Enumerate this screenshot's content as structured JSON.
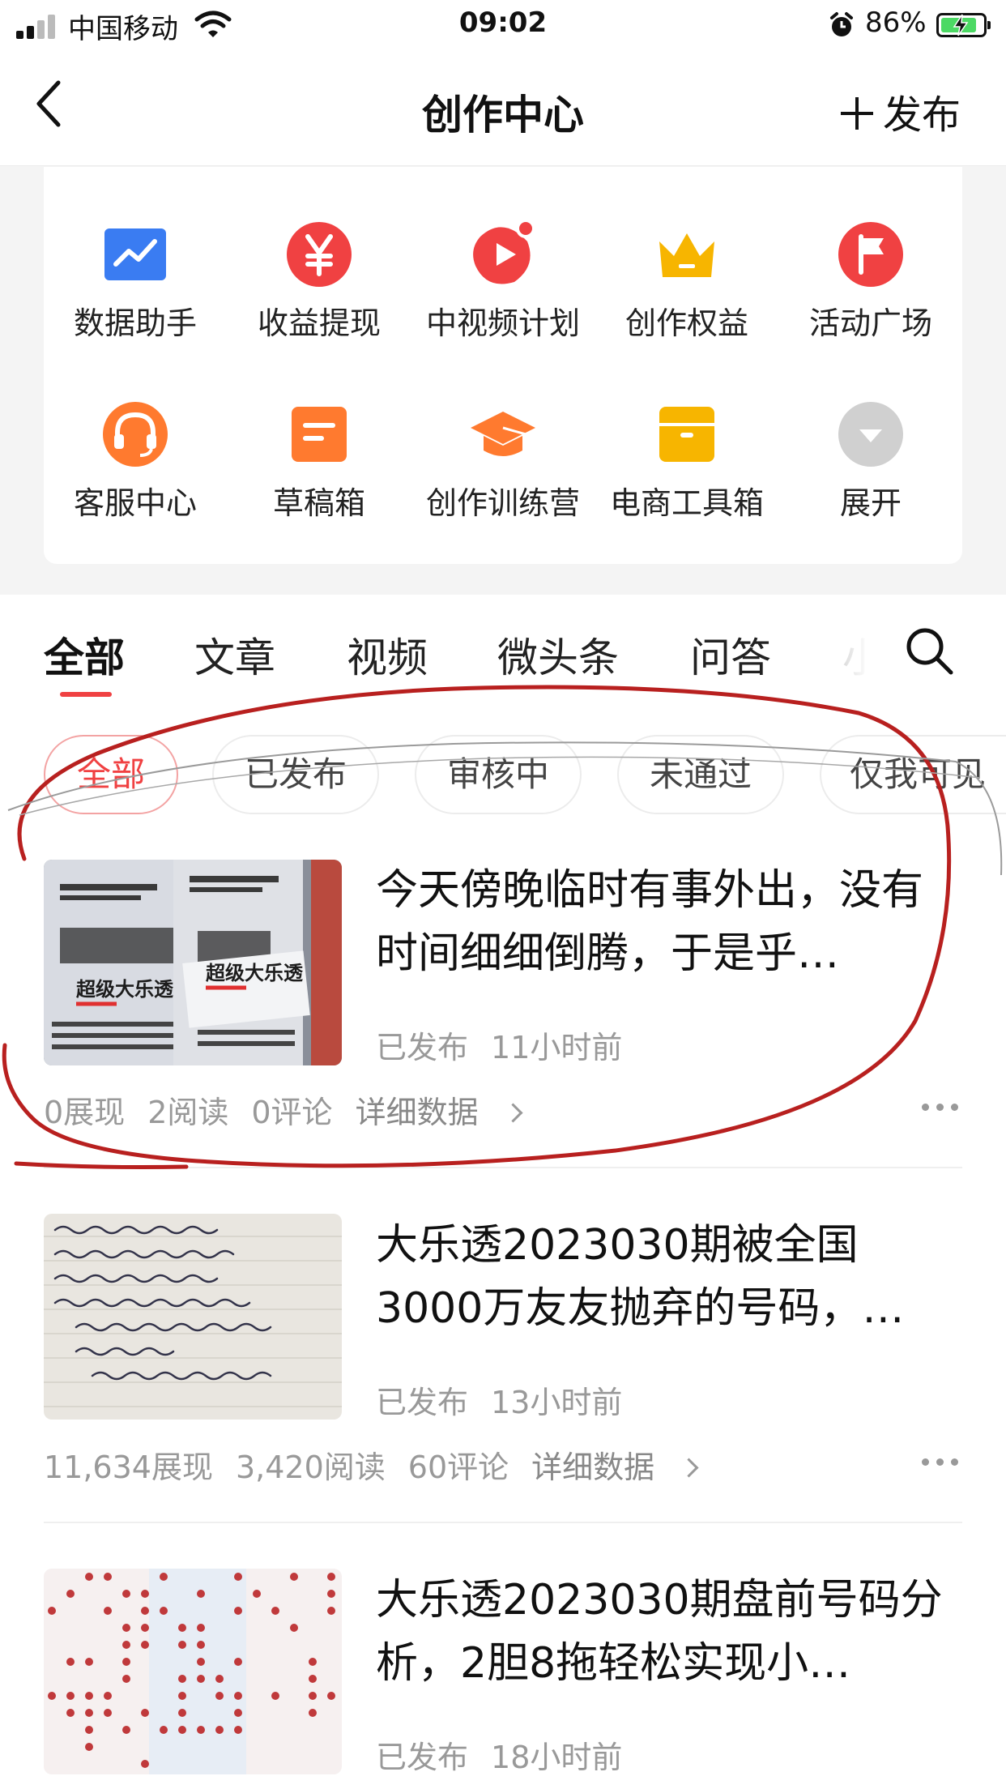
{
  "status_bar": {
    "carrier": "中国移动",
    "time": "09:02",
    "battery": "86%",
    "battery_level": 0.86
  },
  "nav": {
    "title": "创作中心",
    "publish_label": "发布"
  },
  "tools": [
    {
      "label": "数据助手",
      "icon": "chart-icon",
      "color": "#3a7cf2"
    },
    {
      "label": "收益提现",
      "icon": "yen-icon",
      "color": "#f04142"
    },
    {
      "label": "中视频计划",
      "icon": "video-play-icon",
      "color": "#f04142"
    },
    {
      "label": "创作权益",
      "icon": "crown-icon",
      "color": "#f7b500"
    },
    {
      "label": "活动广场",
      "icon": "flag-icon",
      "color": "#f04142"
    },
    {
      "label": "客服中心",
      "icon": "headset-icon",
      "color": "#ff7a2f"
    },
    {
      "label": "草稿箱",
      "icon": "draft-icon",
      "color": "#ff7a2f"
    },
    {
      "label": "创作训练营",
      "icon": "graduation-cap-icon",
      "color": "#ff7a2f"
    },
    {
      "label": "电商工具箱",
      "icon": "box-icon",
      "color": "#f7b500"
    },
    {
      "label": "展开",
      "icon": "expand-icon",
      "color": "#d0d0d0"
    }
  ],
  "tabs": [
    "全部",
    "文章",
    "视频",
    "微头条",
    "问答",
    "小"
  ],
  "filters": [
    "全部",
    "已发布",
    "审核中",
    "未通过",
    "仅我可见"
  ],
  "articles": [
    {
      "title": "今天傍晚临时有事外出，没有时间细细倒腾，于是乎…",
      "status": "已发布",
      "time": "11小时前",
      "stats": [
        "0展现",
        "2阅读",
        "0评论"
      ],
      "detail": "详细数据",
      "thumb_text": "超级大乐透"
    },
    {
      "title": "大乐透2023030期被全国3000万友友抛弃的号码，…",
      "status": "已发布",
      "time": "13小时前",
      "stats": [
        "11,634展现",
        "3,420阅读",
        "60评论"
      ],
      "detail": "详细数据"
    },
    {
      "title": "大乐透2023030期盘前号码分析，2胆8拖轻松实现小…",
      "status": "已发布",
      "time": "18小时前"
    }
  ]
}
